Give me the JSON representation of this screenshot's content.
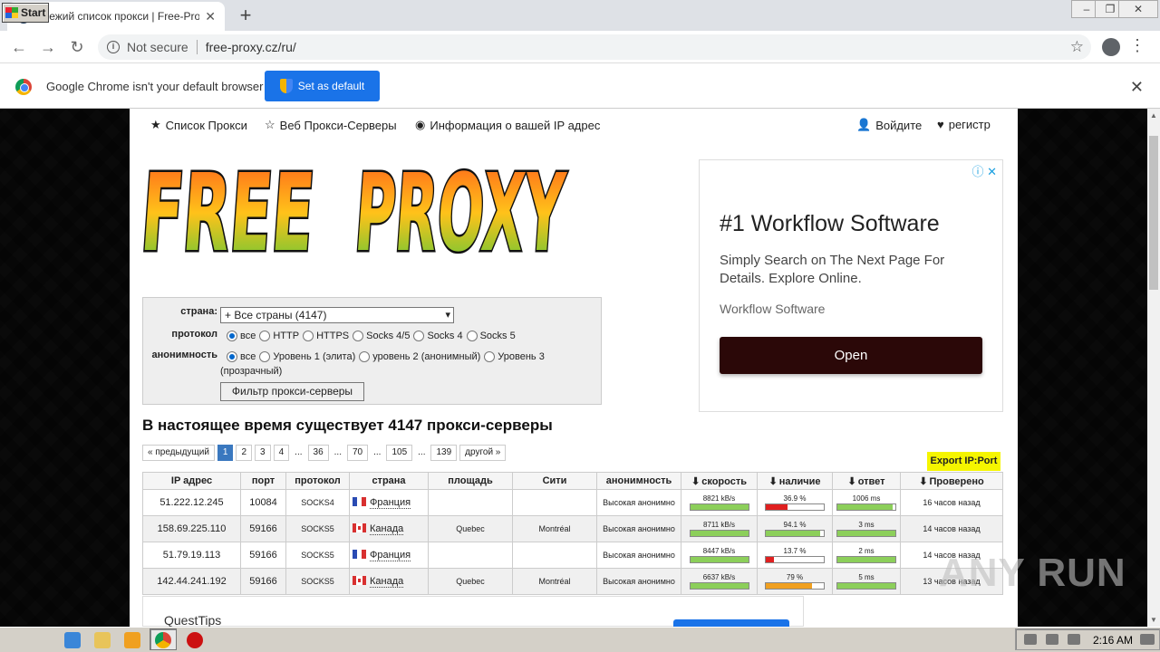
{
  "browser": {
    "tab_title": "свежий список прокси | Free-Proxy",
    "not_secure": "Not secure",
    "url": "free-proxy.cz/ru/",
    "infobar_text": "Google Chrome isn't your default browser",
    "set_default": "Set as default"
  },
  "topnav": {
    "proxy_list": "Список Прокси",
    "web_proxy": "Веб Прокси-Серверы",
    "ip_info": "Информация о вашей IP адрес",
    "login": "Войдите",
    "register": "регистр"
  },
  "logo_text": "FREE PROXY",
  "ad": {
    "title": "#1 Workflow Software",
    "text": "Simply Search on The Next Page For Details. Explore Online.",
    "brand": "Workflow Software",
    "button": "Open"
  },
  "filter": {
    "country_label": "страна:",
    "country_value": "+ Все страны (4147)",
    "protocol_label": "протокол",
    "protocols": [
      "все",
      "HTTP",
      "HTTPS",
      "Socks 4/5",
      "Socks 4",
      "Socks 5"
    ],
    "anonymity_label": "анонимность",
    "anonymity": [
      "все",
      "Уровень 1 (элита)",
      "уровень 2 (анонимный)",
      "Уровень 3"
    ],
    "anonymity_extra": "(прозрачный)",
    "button": "Фильтр прокси-серверы"
  },
  "heading": "В настоящее время существует 4147 прокси-серверы",
  "pager": {
    "prev": "« предыдущий",
    "pages": [
      "1",
      "2",
      "3",
      "4",
      "...",
      "36",
      "...",
      "70",
      "...",
      "105",
      "...",
      "139"
    ],
    "next": "другой »",
    "active": "1"
  },
  "export": "Export IP:Port",
  "table": {
    "headers": [
      "IP адрес",
      "порт",
      "протокол",
      "страна",
      "площадь",
      "Сити",
      "анонимность",
      "скорость",
      "наличие",
      "ответ",
      "Проверено"
    ],
    "rows": [
      {
        "ip": "51.222.12.245",
        "port": "10084",
        "protocol": "SOCKS4",
        "country": "Франция",
        "flag": "fr",
        "region": "",
        "city": "",
        "anon": "Высокая анонимно",
        "speed": "8821 kB/s",
        "speed_pct": 1.0,
        "uptime": "36.9 %",
        "uptime_pct": 0.369,
        "uptime_color": "#e02020",
        "response": "1006 ms",
        "response_pct": 0.95,
        "checked": "16 часов назад"
      },
      {
        "ip": "158.69.225.110",
        "port": "59166",
        "protocol": "SOCKS5",
        "country": "Канада",
        "flag": "ca",
        "region": "Quebec",
        "city": "Montréal",
        "anon": "Высокая анонимно",
        "speed": "8711 kB/s",
        "speed_pct": 1.0,
        "uptime": "94.1 %",
        "uptime_pct": 0.941,
        "uptime_color": "#8ccf5a",
        "response": "3 ms",
        "response_pct": 1.0,
        "checked": "14 часов назад"
      },
      {
        "ip": "51.79.19.113",
        "port": "59166",
        "protocol": "SOCKS5",
        "country": "Франция",
        "flag": "fr",
        "region": "",
        "city": "",
        "anon": "Высокая анонимно",
        "speed": "8447 kB/s",
        "speed_pct": 1.0,
        "uptime": "13.7 %",
        "uptime_pct": 0.137,
        "uptime_color": "#e02020",
        "response": "2 ms",
        "response_pct": 1.0,
        "checked": "14 часов назад"
      },
      {
        "ip": "142.44.241.192",
        "port": "59166",
        "protocol": "SOCKS5",
        "country": "Канада",
        "flag": "ca",
        "region": "Quebec",
        "city": "Montréal",
        "anon": "Высокая анонимно",
        "speed": "6637 kB/s",
        "speed_pct": 1.0,
        "uptime": "79 %",
        "uptime_pct": 0.79,
        "uptime_color": "#f0a020",
        "response": "5 ms",
        "response_pct": 1.0,
        "checked": "13 часов назад"
      }
    ]
  },
  "ad2": {
    "title": "QuestTips"
  },
  "watermark": "ANY RUN",
  "taskbar": {
    "start": "Start",
    "clock": "2:16 AM"
  },
  "colors": {
    "bar_green": "#8ccf5a",
    "accent": "#1a73e8"
  }
}
